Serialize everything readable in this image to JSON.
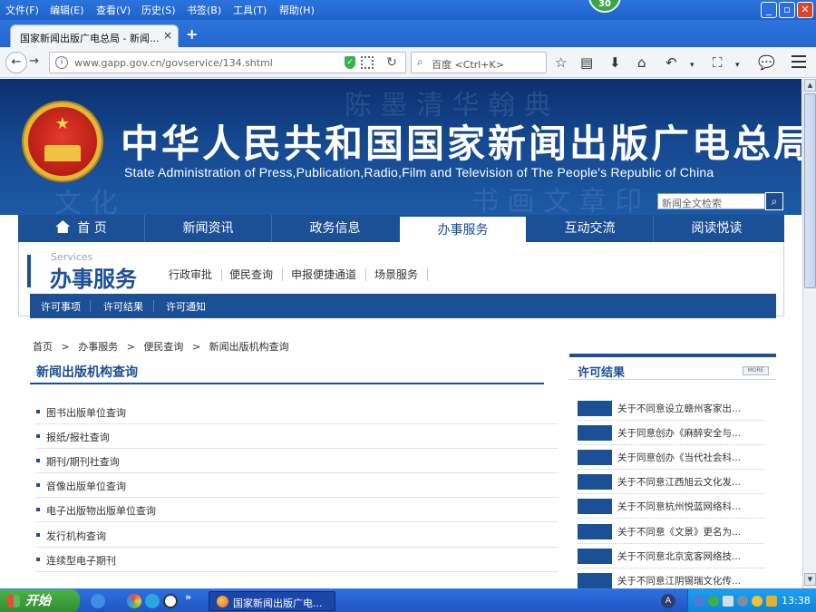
{
  "browser": {
    "menu": [
      "文件(F)",
      "编辑(E)",
      "查看(V)",
      "历史(S)",
      "书签(B)",
      "工具(T)",
      "帮助(H)"
    ],
    "badge": "30",
    "tab_title": "国家新闻出版广电总局 - 新闻...",
    "tab_close": "×",
    "new_tab": "+",
    "url": "www.gapp.gov.cn/govservice/134.shtml",
    "search_placeholder": "百度 <Ctrl+K>"
  },
  "site": {
    "title": "中华人民共和国国家新闻出版广电总局",
    "subtitle": "State Administration of Press,Publication,Radio,Film and Television of The People's Republic of China",
    "search_placeholder": "新闻全文检索",
    "nav": [
      "首 页",
      "新闻资讯",
      "政务信息",
      "办事服务",
      "互动交流",
      "阅读悦读"
    ],
    "active_nav_index": 3
  },
  "section": {
    "en": "Services",
    "cn": "办事服务",
    "tabs": [
      "行政审批",
      "便民查询",
      "申报便捷通道",
      "场景服务"
    ],
    "subtabs": [
      "许可事项",
      "许可结果",
      "许可通知"
    ]
  },
  "breadcrumb": [
    "首页",
    ">",
    "办事服务",
    ">",
    "便民查询",
    ">",
    "新闻出版机构查询"
  ],
  "left": {
    "title": "新闻出版机构查询",
    "items": [
      "图书出版单位查询",
      "报纸/报社查询",
      "期刊/期刊社查询",
      "音像出版单位查询",
      "电子出版物出版单位查询",
      "发行机构查询",
      "连续型电子期刊"
    ]
  },
  "right": {
    "title": "许可结果",
    "more": "MORE",
    "items": [
      "关于不同意设立赣州客家出...",
      "关于同意创办《麻醉安全与...",
      "关于同意创办《当代社会科...",
      "关于不同意江西旭云文化发...",
      "关于不同意杭州悦蓝网络科...",
      "关于不同意《文景》更名为...",
      "关于不同意北京宽客网络技...",
      "关于不同意江阴锡瑞文化传..."
    ]
  },
  "taskbar": {
    "start": "开始",
    "window_title": "国家新闻出版广电...",
    "clock": "13:38"
  },
  "colors": {
    "brand_blue": "#1b4f96",
    "banner_dark": "#0b2f6e",
    "xp_green": "#3aa64a"
  }
}
